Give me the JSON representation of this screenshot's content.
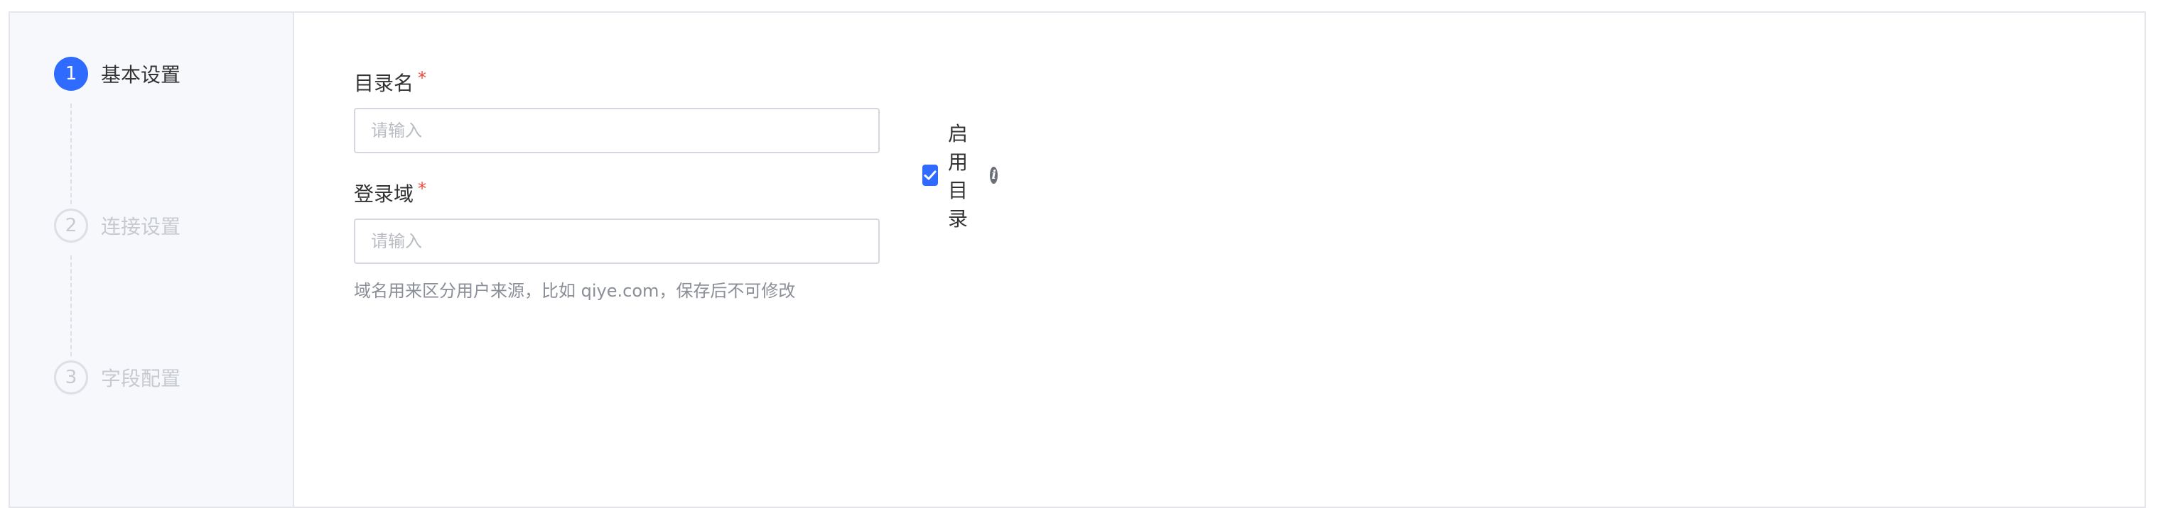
{
  "steps": [
    {
      "number": "1",
      "label": "基本设置",
      "state": "active"
    },
    {
      "number": "2",
      "label": "连接设置",
      "state": "pending"
    },
    {
      "number": "3",
      "label": "字段配置",
      "state": "pending"
    }
  ],
  "form": {
    "directory_name": {
      "label": "目录名",
      "required_mark": "*",
      "placeholder": "请输入",
      "value": ""
    },
    "enable_directory": {
      "label": "启用目录",
      "checked": true,
      "info_icon": "info-icon"
    },
    "login_domain": {
      "label": "登录域",
      "required_mark": "*",
      "placeholder": "请输入",
      "value": "",
      "help": "域名用来区分用户来源，比如 qiye.com，保存后不可修改"
    }
  },
  "colors": {
    "accent": "#2f6bff",
    "required": "#f5483b",
    "sidebar_bg": "#f7f8fc",
    "muted_text": "#c6c9d0"
  }
}
